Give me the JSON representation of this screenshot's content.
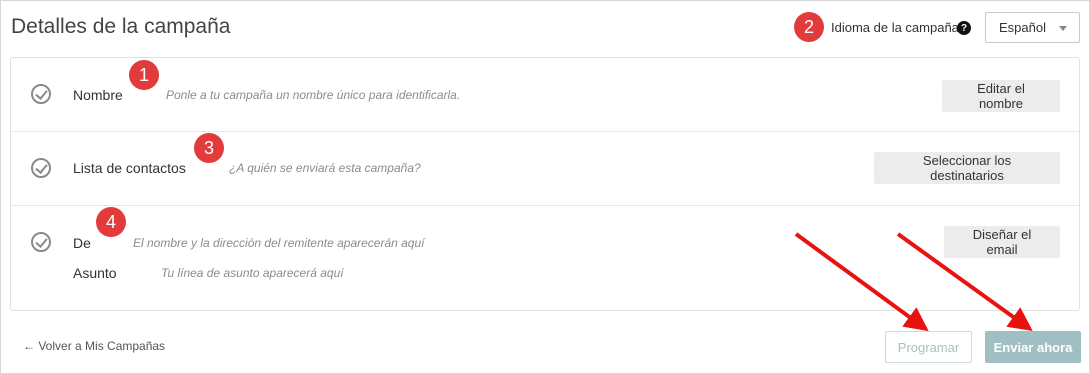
{
  "header": {
    "title": "Detalles de la campaña",
    "language_label": "Idioma de la campaña",
    "help_icon_glyph": "?",
    "language_selected": "Español"
  },
  "badges": [
    "1",
    "2",
    "3",
    "4"
  ],
  "rows": {
    "name": {
      "label": "Nombre",
      "hint": "Ponle a tu campaña un nombre único para identificarla.",
      "button": "Editar el nombre"
    },
    "contacts": {
      "label": "Lista de contactos",
      "hint": "¿A quién se enviará esta campaña?",
      "button": "Seleccionar los destinatarios"
    },
    "sender": {
      "label": "De",
      "hint": "El nombre y la dirección del remitente aparecerán aquí",
      "subject_label": "Asunto",
      "subject_hint": "Tu línea de asunto aparecerá aquí",
      "button": "Diseñar el email"
    }
  },
  "footer": {
    "back_link": "← Volver a Mis Campañas",
    "schedule_button": "Programar",
    "send_button": "Enviar ahora"
  },
  "colors": {
    "badge": "#e23b3b",
    "arrow": "#e8120f",
    "primary_button": "#9fbfc2"
  },
  "icons": {
    "check": "check-circle-icon",
    "help": "question-circle-icon",
    "dropdown": "chevron-down-icon"
  }
}
